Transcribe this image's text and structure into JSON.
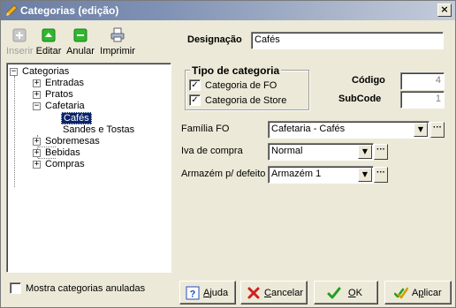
{
  "window": {
    "title": "Categorias (edição)",
    "close_glyph": "×"
  },
  "toolbar": {
    "insert": "Inserir",
    "edit": "Editar",
    "cancel_item": "Anular",
    "print": "Imprimir"
  },
  "tree": {
    "root": "Categorias",
    "items": [
      {
        "label": "Entradas",
        "expander": "+"
      },
      {
        "label": "Pratos",
        "expander": "+"
      },
      {
        "label": "Cafetaria",
        "expander": "−"
      },
      {
        "label": "Cafés",
        "selected": true
      },
      {
        "label": "Sandes e Tostas"
      },
      {
        "label": "Sobremesas",
        "expander": "+"
      },
      {
        "label": "Bebidas",
        "expander": "+"
      },
      {
        "label": "Compras",
        "expander": "+"
      }
    ],
    "root_expander": "−"
  },
  "form": {
    "designation_label": "Designação",
    "designation_value": "Cafés",
    "category_type": {
      "title": "Tipo de categoria",
      "options": [
        {
          "label": "Categoria de FO",
          "checked": true
        },
        {
          "label": "Categoria de Store",
          "checked": true
        }
      ]
    },
    "code_label": "Código",
    "code_value": "4",
    "subcode_label": "SubCode",
    "subcode_value": "1",
    "family_label": "Família FO",
    "family_value": "Cafetaria - Cafés",
    "iva_label": "Iva de compra",
    "iva_value": "Normal",
    "warehouse_label": "Armazém p/ defeito",
    "warehouse_value": "Armazém 1",
    "check_glyph": "✓",
    "ellipsis": "···",
    "dropdown_glyph": "▼"
  },
  "footer": {
    "show_cancelled_label": "Mostra categorias anuladas",
    "show_cancelled_checked": false,
    "help": {
      "prefix": "",
      "mnemonic": "A",
      "rest": "juda"
    },
    "cancel": {
      "prefix": "",
      "mnemonic": "C",
      "rest": "ancelar"
    },
    "ok": {
      "prefix": "",
      "mnemonic": "O",
      "rest": "K"
    },
    "apply": {
      "prefix": "A",
      "mnemonic": "p",
      "rest": "licar"
    }
  },
  "colors": {
    "title_gradient_start": "#6b7ea3",
    "selection": "#0a246a",
    "face": "#ece9d8"
  }
}
